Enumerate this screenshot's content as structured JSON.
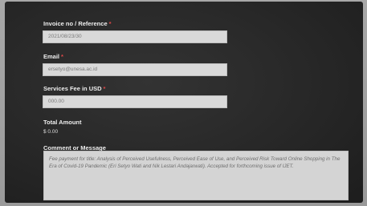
{
  "form": {
    "invoice": {
      "label": "Invoice no / Reference",
      "required_mark": "*",
      "value": "2021/08/23/30"
    },
    "email": {
      "label": "Email",
      "required_mark": "*",
      "value": "ersetyo@unesa.ac.id"
    },
    "fee": {
      "label": "Services Fee in USD",
      "required_mark": "*",
      "value": "000.00"
    },
    "total": {
      "label": "Total Amount",
      "value": "$ 0.00"
    },
    "comment": {
      "label": "Comment or Message",
      "value": "Fee payment for title: Analysis of Perceived Usefulness, Perceived Ease of Use, and Perceived Risk Toward Online Shopping in The Era of Covid-19 Pandemic (Eri Setyo Wati and Nik Lestari Andajarwati). Accepted for forthcoming issue of IJET."
    }
  }
}
